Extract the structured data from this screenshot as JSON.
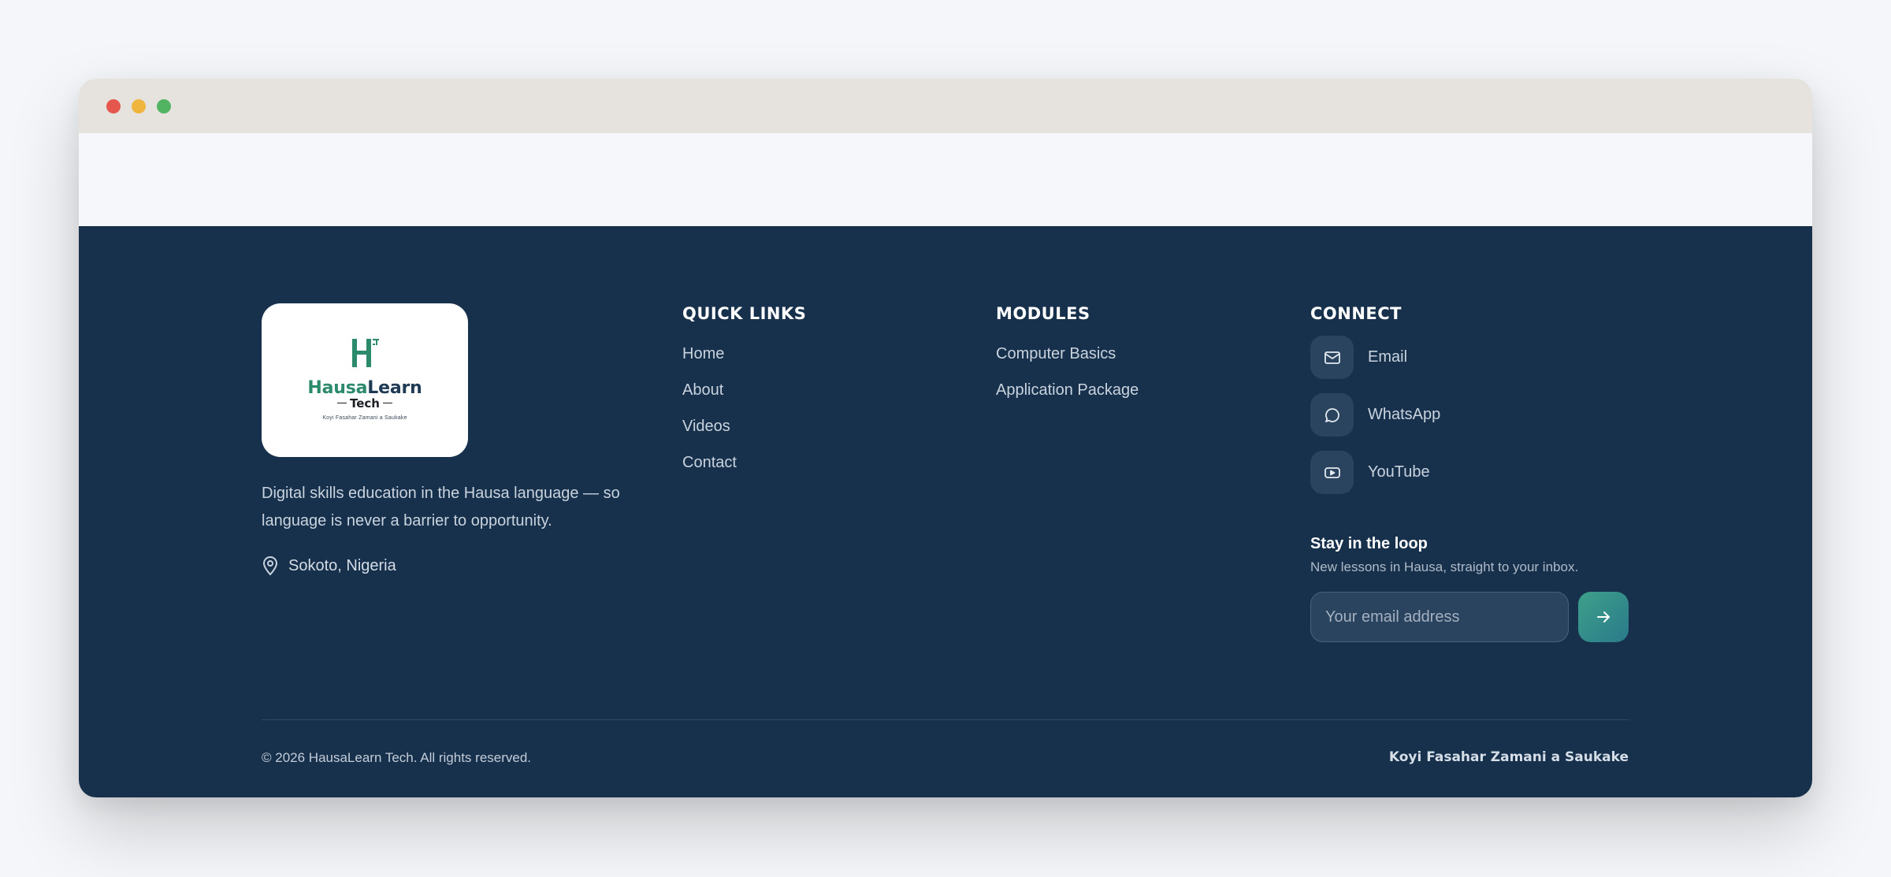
{
  "window": {
    "controls": [
      "close",
      "minimize",
      "maximize"
    ]
  },
  "brand": {
    "logo_name_part1": "Hausa",
    "logo_name_part2": "Learn",
    "logo_sub": "Tech",
    "logo_tagline": "Koyi Fasahar Zamani a Saukake",
    "description": "Digital skills education in the Hausa language — so language is never a barrier to opportunity.",
    "location": "Sokoto, Nigeria",
    "location_icon": "map-pin-icon"
  },
  "quick_links": {
    "heading": "QUICK LINKS",
    "items": [
      "Home",
      "About",
      "Videos",
      "Contact"
    ]
  },
  "modules": {
    "heading": "MODULES",
    "items": [
      "Computer Basics",
      "Application Package"
    ]
  },
  "connect": {
    "heading": "CONNECT",
    "items": [
      {
        "label": "Email",
        "icon": "mail-icon"
      },
      {
        "label": "WhatsApp",
        "icon": "chat-bubble-icon"
      },
      {
        "label": "YouTube",
        "icon": "youtube-icon"
      }
    ]
  },
  "newsletter": {
    "title": "Stay in the loop",
    "subtitle": "New lessons in Hausa, straight to your inbox.",
    "placeholder": "Your email address",
    "submit_icon": "arrow-right-icon"
  },
  "bottom": {
    "copyright": "© 2026 HausaLearn Tech. All rights reserved.",
    "credit": "Koyi Fasahar Zamani a Saukake"
  },
  "colors": {
    "footer_bg": "#17314d",
    "accent": "#2c8a6c",
    "titlebar": "#e6e3de"
  }
}
